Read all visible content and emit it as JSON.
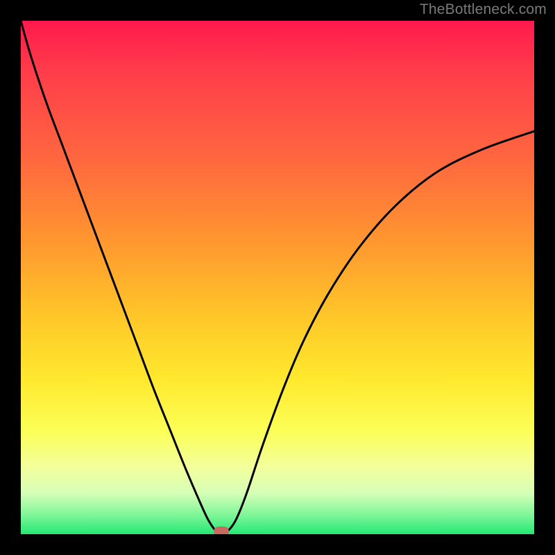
{
  "watermark": "TheBottleneck.com",
  "chart_data": {
    "type": "line",
    "title": "",
    "xlabel": "",
    "ylabel": "",
    "xlim": [
      0,
      100
    ],
    "ylim": [
      0,
      100
    ],
    "grid": false,
    "series": [
      {
        "name": "bottleneck-curve",
        "x": [
          0,
          2,
          5,
          8,
          11,
          14,
          17,
          20,
          23,
          26,
          29,
          32,
          35,
          36.5,
          38,
          39,
          40.5,
          42,
          44,
          47,
          51,
          55,
          60,
          66,
          73,
          81,
          90,
          100
        ],
        "y": [
          100,
          93,
          84,
          76,
          68,
          60,
          52,
          44,
          36,
          28,
          20.5,
          13,
          6,
          2.8,
          0.6,
          0,
          0.8,
          3,
          8,
          17,
          28,
          37.5,
          47,
          56,
          64,
          70.5,
          75,
          78.5
        ]
      }
    ],
    "minimum_marker": {
      "x": 39,
      "y": 0
    },
    "colors": {
      "gradient_top": "#ff1a4d",
      "gradient_mid": "#ffe92e",
      "gradient_bottom": "#22e873",
      "curve": "#000000",
      "marker": "#c86a5f",
      "frame": "#000000"
    }
  }
}
